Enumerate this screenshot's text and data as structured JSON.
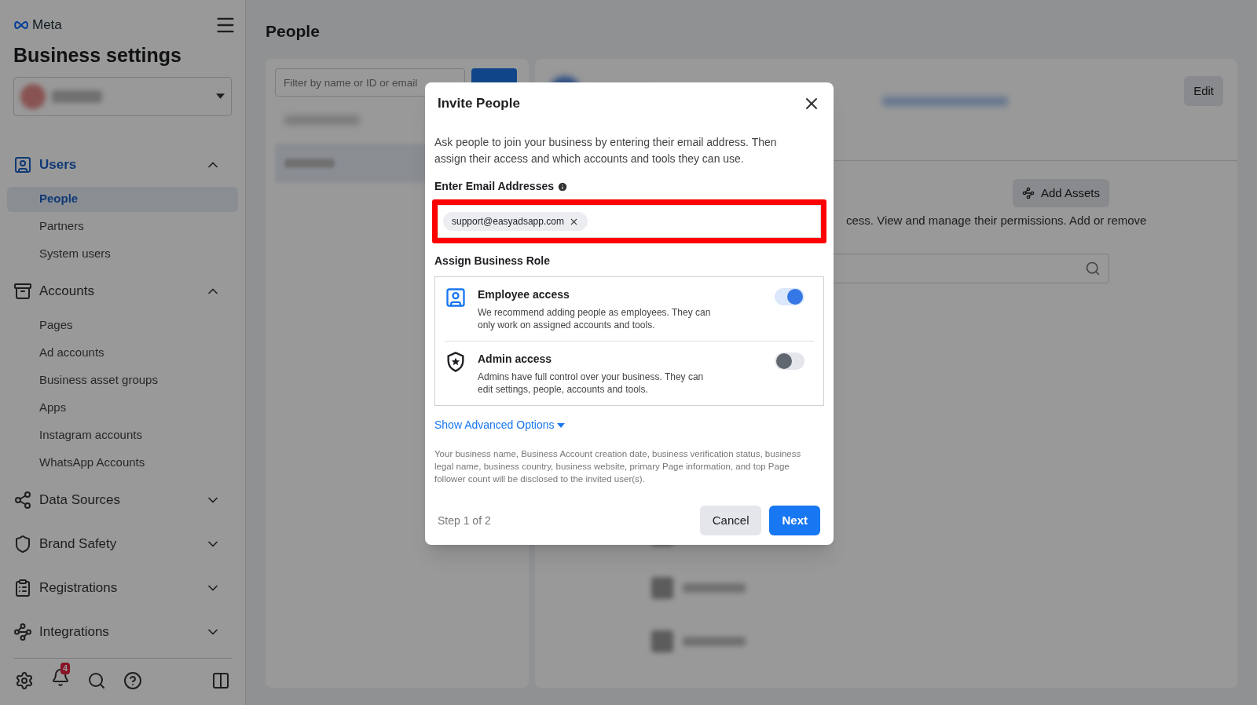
{
  "sidebar": {
    "brand": "Meta",
    "title": "Business settings",
    "sections": [
      {
        "kind": "users",
        "label": "Users",
        "expanded": true,
        "items": [
          {
            "label": "People",
            "selected": true
          },
          {
            "label": "Partners",
            "selected": false
          },
          {
            "label": "System users",
            "selected": false
          }
        ]
      },
      {
        "kind": "accounts",
        "label": "Accounts",
        "expanded": true,
        "items": [
          {
            "label": "Pages",
            "selected": false
          },
          {
            "label": "Ad accounts",
            "selected": false
          },
          {
            "label": "Business asset groups",
            "selected": false
          },
          {
            "label": "Apps",
            "selected": false
          },
          {
            "label": "Instagram accounts",
            "selected": false
          },
          {
            "label": "WhatsApp Accounts",
            "selected": false
          }
        ]
      },
      {
        "kind": "data",
        "label": "Data Sources",
        "expanded": false
      },
      {
        "kind": "safety",
        "label": "Brand Safety",
        "expanded": false
      },
      {
        "kind": "registrations",
        "label": "Registrations",
        "expanded": false
      },
      {
        "kind": "integrations",
        "label": "Integrations",
        "expanded": false
      }
    ],
    "notification_count": "4"
  },
  "page": {
    "title": "People",
    "filter": {
      "placeholder": "Filter by name or ID or email"
    },
    "edit_button": "Edit",
    "add_assets_button": "Add Assets",
    "description_fragment": "cess. View and manage their permissions. Add or remove"
  },
  "dialog": {
    "title": "Invite People",
    "intro": "Ask people to join your business by entering their email address. Then assign their access and which accounts and tools they can use.",
    "email_label": "Enter Email Addresses",
    "emails": [
      "support@easyadsapp.com"
    ],
    "role_label": "Assign Business Role",
    "roles": [
      {
        "kind": "employee",
        "title": "Employee access",
        "description": "We recommend adding people as employees. They can only work on assigned accounts and tools.",
        "on": true
      },
      {
        "kind": "admin",
        "title": "Admin access",
        "description": "Admins have full control over your business. They can edit settings, people, accounts and tools.",
        "on": false
      }
    ],
    "advanced_link": "Show Advanced Options",
    "disclosure": "Your business name, Business Account creation date, business verification status, business legal name, business country, business website, primary Page information, and top Page follower count will be disclosed to the invited user(s).",
    "step": "Step 1 of 2",
    "cancel_button": "Cancel",
    "next_button": "Next"
  }
}
